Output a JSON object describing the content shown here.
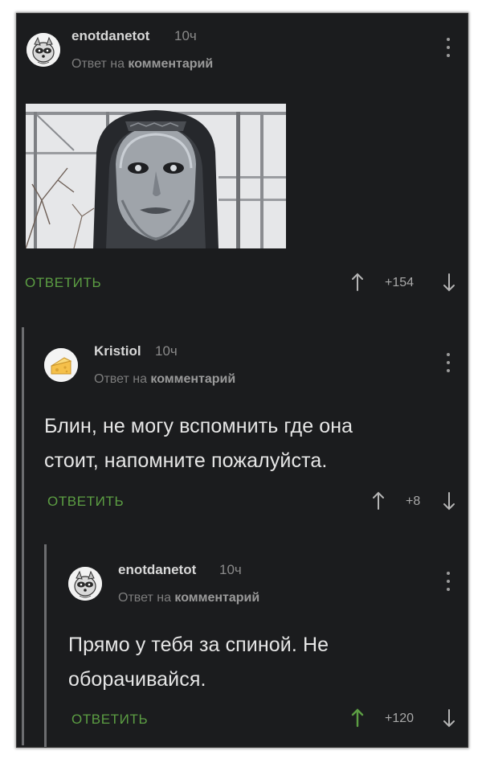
{
  "comments": [
    {
      "username": "enotdanetot",
      "time": "10ч",
      "reply_prefix": "Ответ на",
      "reply_target": "комментарий",
      "text_lines": [],
      "reply_label": "ОТВЕТИТЬ",
      "votes": "+154",
      "avatar": "raccoon-avatar",
      "image": "dark-hooded-statue-face-photo"
    },
    {
      "username": "Kristiol",
      "time": "10ч",
      "reply_prefix": "Ответ на",
      "reply_target": "комментарий",
      "text_lines": [
        "Блин, не могу вспомнить где она",
        "стоит, напомните пожалуйста."
      ],
      "reply_label": "ОТВЕТИТЬ",
      "votes": "+8",
      "avatar": "cheese-avatar"
    },
    {
      "username": "enotdanetot",
      "time": "10ч",
      "reply_prefix": "Ответ на",
      "reply_target": "комментарий",
      "text_lines": [
        "Прямо у тебя за спиной. Не",
        "оборачивайся."
      ],
      "reply_label": "ОТВЕТИТЬ",
      "votes": "+120",
      "avatar": "raccoon-avatar",
      "upvoted": true
    }
  ],
  "colors": {
    "background": "#1b1c1e",
    "accent_green": "#5c9e43",
    "text": "#e6e6e6",
    "muted": "#8a8a8a"
  }
}
